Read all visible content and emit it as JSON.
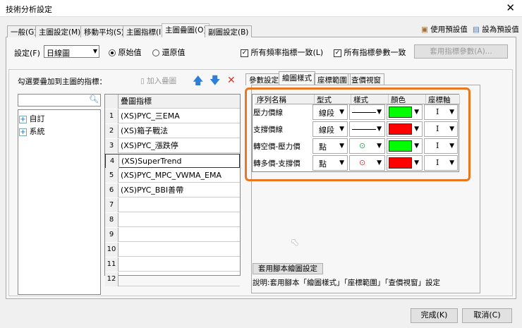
{
  "window": {
    "title": "技術分析設定",
    "close": "✕"
  },
  "tabs": [
    {
      "label": "一般(G)"
    },
    {
      "label": "主圖設定(M)"
    },
    {
      "label": "移動平均(S)"
    },
    {
      "label": "主圖指標(I)"
    },
    {
      "label": "主圖疊圖(O)",
      "active": true
    },
    {
      "label": "副圖設定(B)"
    }
  ],
  "header_actions": {
    "use_default": "使用預設值",
    "set_default": "設為預設值"
  },
  "settings": {
    "label": "設定(F)",
    "value": "日線圖",
    "radio_original": "原始值",
    "radio_restore": "還原值",
    "selected": "原始值",
    "chk_freq": "所有頻率指標一致(L)",
    "chk_freq_checked": true,
    "chk_param": "所有指標參數一致",
    "chk_param_checked": true,
    "apply_params": "套用指標參數(A)..."
  },
  "left": {
    "prompt": "勾選要疊加到主圖的指標：",
    "add_overlay": "加入疊圖",
    "search_placeholder": "",
    "tree": [
      {
        "label": "自訂"
      },
      {
        "label": "系統"
      }
    ]
  },
  "grid": {
    "header": "疊圖指標",
    "rows": [
      {
        "n": "1",
        "v": "(XS)PYC_三EMA"
      },
      {
        "n": "2",
        "v": "(XS)箱子戰法"
      },
      {
        "n": "3",
        "v": "(XS)PYC_漲跌停"
      },
      {
        "n": "4",
        "v": "(XS)SuperTrend"
      },
      {
        "n": "5",
        "v": "(XS)PYC_MPC_VWMA_EMA"
      },
      {
        "n": "6",
        "v": "(XS)PYC_BBI善帶"
      },
      {
        "n": "7",
        "v": ""
      },
      {
        "n": "8",
        "v": ""
      },
      {
        "n": "9",
        "v": ""
      },
      {
        "n": "10",
        "v": ""
      },
      {
        "n": "11",
        "v": ""
      },
      {
        "n": "12",
        "v": ""
      }
    ]
  },
  "subtabs": [
    {
      "label": "參數設定"
    },
    {
      "label": "繪圖樣式",
      "active": true
    },
    {
      "label": "座標範圍"
    },
    {
      "label": "查價視窗"
    }
  ],
  "style_table": {
    "headers": [
      "序列名稱",
      "型式",
      "樣式",
      "顏色",
      "座標軸"
    ],
    "rows": [
      {
        "name": "壓力價線",
        "type": "線段",
        "style": "line",
        "color": "#00ff00",
        "axis": "I"
      },
      {
        "name": "支撐價線",
        "type": "線段",
        "style": "line",
        "color": "#ff0000",
        "axis": "I"
      },
      {
        "name": "轉空價-壓力價",
        "type": "點",
        "style": "dot",
        "dot_color": "#22aa55",
        "color": "#00ff00",
        "axis": "I"
      },
      {
        "name": "轉多價-支撐價",
        "type": "點",
        "style": "dot",
        "dot_color": "#dd3333",
        "color": "#ff0000",
        "axis": "I"
      }
    ]
  },
  "apply_script": "套用腳本繪圖設定",
  "note": "說明:套用腳本「繪圖樣式」「座標範圍」「查價視窗」設定",
  "footer": {
    "ok": "完成(K)",
    "cancel": "取消(C)"
  },
  "highlight_color": "#e87722"
}
